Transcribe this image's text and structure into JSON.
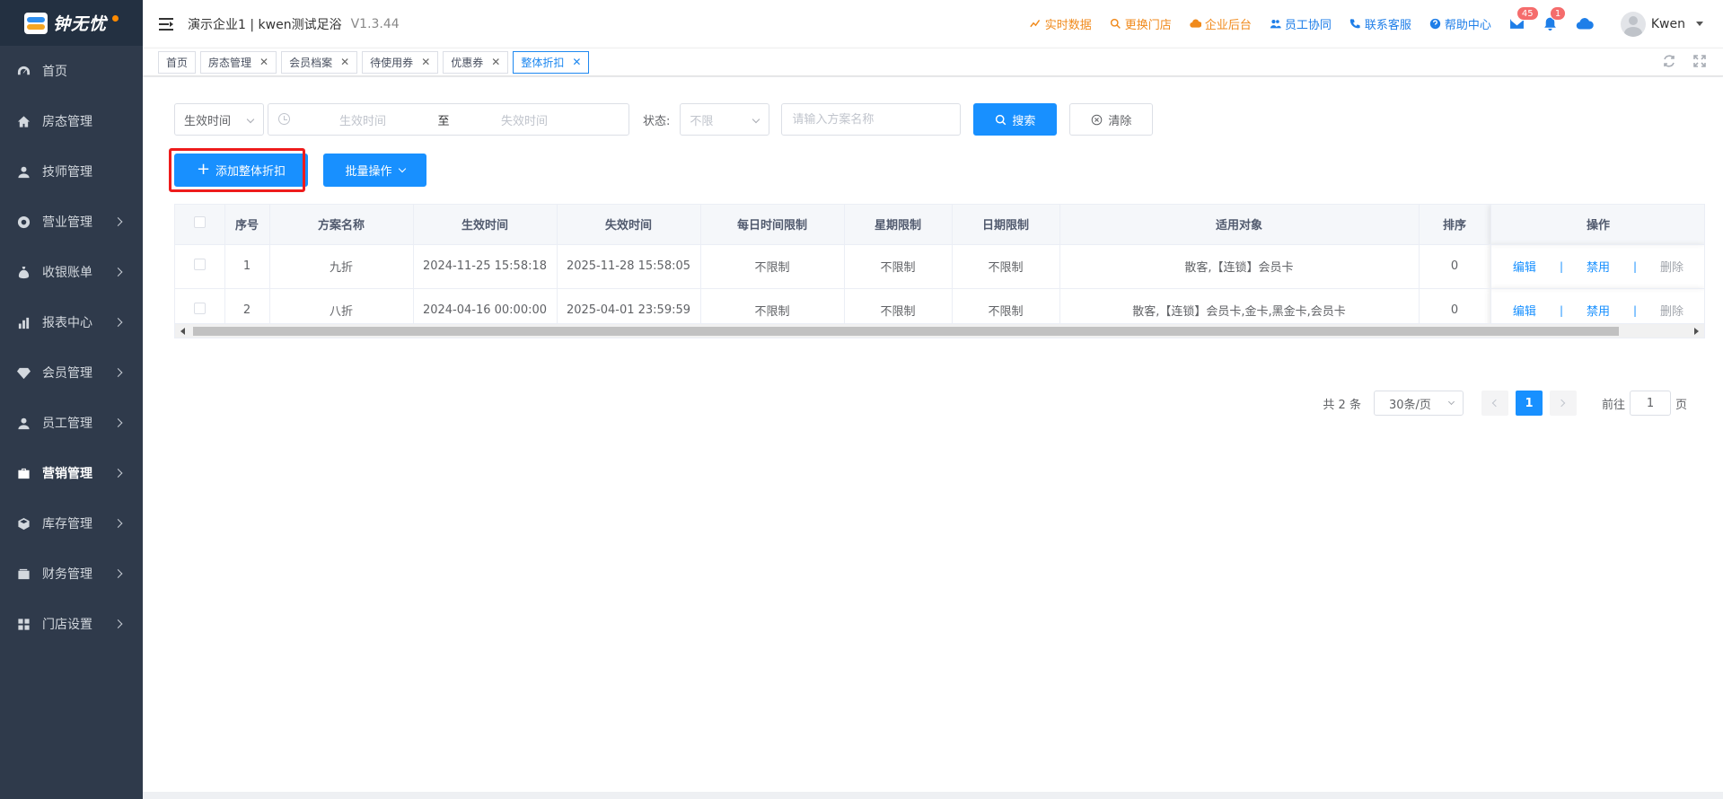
{
  "sidebar": {
    "logo_text": "钟无忧",
    "items": [
      {
        "label": "首页",
        "icon": "dashboard-icon"
      },
      {
        "label": "房态管理",
        "icon": "home-icon"
      },
      {
        "label": "技师管理",
        "icon": "user-icon"
      },
      {
        "label": "营业管理",
        "icon": "settings-icon"
      },
      {
        "label": "收银账单",
        "icon": "money-bag-icon"
      },
      {
        "label": "报表中心",
        "icon": "bar-chart-icon"
      },
      {
        "label": "会员管理",
        "icon": "diamond-icon"
      },
      {
        "label": "员工管理",
        "icon": "user-icon"
      },
      {
        "label": "营销管理",
        "icon": "briefcase-icon"
      },
      {
        "label": "库存管理",
        "icon": "cube-icon"
      },
      {
        "label": "财务管理",
        "icon": "wallet-icon"
      },
      {
        "label": "门店设置",
        "icon": "grid-icon"
      }
    ]
  },
  "header": {
    "title": "演示企业1 | kwen测试足浴",
    "version": "V1.3.44",
    "links": [
      {
        "label": "实时数据",
        "color": "#f08a1c",
        "icon": "trend-icon"
      },
      {
        "label": "更换门店",
        "color": "#f08a1c",
        "icon": "search-icon"
      },
      {
        "label": "企业后台",
        "color": "#f08a1c",
        "icon": "cloud-icon"
      },
      {
        "label": "员工协同",
        "color": "#1e7ee8",
        "icon": "users-icon"
      },
      {
        "label": "联系客服",
        "color": "#1e7ee8",
        "icon": "phone-icon"
      },
      {
        "label": "帮助中心",
        "color": "#1e7ee8",
        "icon": "help-icon"
      }
    ],
    "mail_badge": "45",
    "bell_badge": "1",
    "user_name": "Kwen"
  },
  "tabs": [
    {
      "label": "首页",
      "closable": false,
      "active": false
    },
    {
      "label": "房态管理",
      "closable": true,
      "active": false
    },
    {
      "label": "会员档案",
      "closable": true,
      "active": false
    },
    {
      "label": "待使用券",
      "closable": true,
      "active": false
    },
    {
      "label": "优惠券",
      "closable": true,
      "active": false
    },
    {
      "label": "整体折扣",
      "closable": true,
      "active": true
    }
  ],
  "filters": {
    "time_type": "生效时间",
    "start_placeholder": "生效时间",
    "range_separator": "至",
    "end_placeholder": "失效时间",
    "status_label": "状态:",
    "status_value": "不限",
    "name_placeholder": "请输入方案名称",
    "search_label": "搜索",
    "clear_label": "清除"
  },
  "actions": {
    "add_label": "添加整体折扣",
    "batch_label": "批量操作"
  },
  "table": {
    "columns": [
      "序号",
      "方案名称",
      "生效时间",
      "失效时间",
      "每日时间限制",
      "星期限制",
      "日期限制",
      "适用对象",
      "排序",
      "操作"
    ],
    "rows": [
      {
        "index": "1",
        "name": "九折",
        "start": "2024-11-25 15:58:18",
        "end": "2025-11-28 15:58:05",
        "daily": "不限制",
        "week": "不限制",
        "date": "不限制",
        "target": "散客,【连锁】会员卡",
        "sort": "0"
      },
      {
        "index": "2",
        "name": "八折",
        "start": "2024-04-16 00:00:00",
        "end": "2025-04-01 23:59:59",
        "daily": "不限制",
        "week": "不限制",
        "date": "不限制",
        "target": "散客,【连锁】会员卡,金卡,黑金卡,会员卡",
        "sort": "0"
      }
    ],
    "op_edit": "编辑",
    "op_disable": "禁用",
    "op_delete": "删除",
    "op_sep": "|"
  },
  "pagination": {
    "total": "共 2 条",
    "page_size": "30条/页",
    "current": "1",
    "goto_prefix": "前往",
    "goto_value": "1",
    "goto_suffix": "页"
  }
}
